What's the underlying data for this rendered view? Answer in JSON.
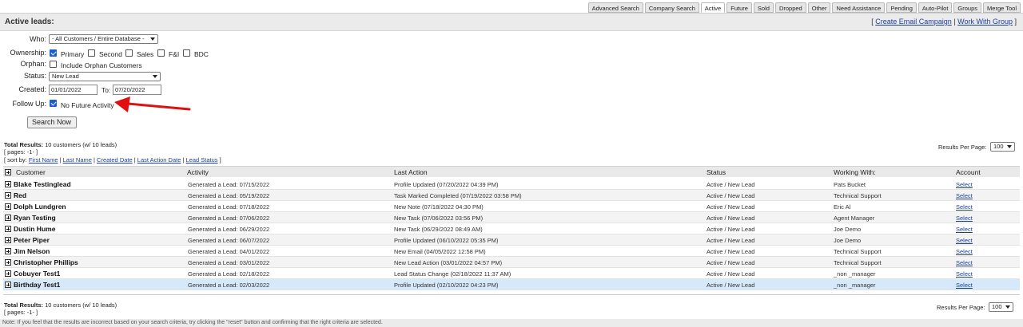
{
  "tabs": [
    {
      "label": "Advanced Search",
      "active": false
    },
    {
      "label": "Company Search",
      "active": false
    },
    {
      "label": "Active",
      "active": true
    },
    {
      "label": "Future",
      "active": false
    },
    {
      "label": "Sold",
      "active": false
    },
    {
      "label": "Dropped",
      "active": false
    },
    {
      "label": "Other",
      "active": false
    },
    {
      "label": "Need Assistance",
      "active": false
    },
    {
      "label": "Pending",
      "active": false
    },
    {
      "label": "Auto-Pilot",
      "active": false
    },
    {
      "label": "Groups",
      "active": false
    },
    {
      "label": "Merge Tool",
      "active": false
    }
  ],
  "header": {
    "title": "Active leads:",
    "link_open": "[ ",
    "create_email_campaign": "Create Email Campaign",
    "link_sep": " | ",
    "work_with_group": "Work With Group",
    "link_close": " ]"
  },
  "filters": {
    "who_label": "Who:",
    "who_value": "- All Customers / Entire Database -",
    "ownership_label": "Ownership:",
    "primary": "Primary",
    "second": "Second",
    "sales": "Sales",
    "fi": "F&I",
    "bdc": "BDC",
    "orphan_label": "Orphan:",
    "include_orphan": "Include Orphan Customers",
    "status_label": "Status:",
    "status_value": "New Lead",
    "created_label": "Created:",
    "created_from": "01/01/2022",
    "to_label": "To:",
    "created_to": "07/20/2022",
    "followup_label": "Follow Up:",
    "no_future_activity": "No Future Activity",
    "search_button": "Search Now"
  },
  "results": {
    "total_label": "Total Results:",
    "total_text": " 10 customers (w/ 10 leads)",
    "pages_text": "[ pages: -1- ]",
    "sort_prefix": "[ sort by: ",
    "sort_first_name": "First Name",
    "sort_last_name": "Last Name",
    "sort_created_date": "Created Date",
    "sort_last_action_date": "Last Action Date",
    "sort_lead_status": "Lead Status",
    "sort_suffix": " ]",
    "sep": " | ",
    "per_page_label": "Results Per Page:",
    "per_page_value": "100"
  },
  "table": {
    "columns": {
      "customer": "Customer",
      "activity": "Activity",
      "last_action": "Last Action",
      "status": "Status",
      "working_with": "Working With:",
      "account": "Account"
    },
    "rows": [
      {
        "name": "Blake Testinglead",
        "activity": "Generated a Lead: 07/15/2022",
        "last_action": "Profile Updated  (07/20/2022 04:39 PM)",
        "status": "Active / New Lead",
        "working_with": "Pats Bucket",
        "account": "Select"
      },
      {
        "name": "Red",
        "activity": "Generated a Lead: 05/19/2022",
        "last_action": "Task Marked Completed (07/19/2022 03:58 PM)",
        "status": "Active / New Lead",
        "working_with": "Technical Support",
        "account": "Select"
      },
      {
        "name": "Dolph Lundgren",
        "activity": "Generated a Lead: 07/18/2022",
        "last_action": "New Note (07/18/2022 04:30 PM)",
        "status": "Active / New Lead",
        "working_with": "Eric Al",
        "account": "Select"
      },
      {
        "name": "Ryan Testing",
        "activity": "Generated a Lead: 07/06/2022",
        "last_action": "New Task (07/06/2022 03:56 PM)",
        "status": "Active / New Lead",
        "working_with": "Agent Manager",
        "account": "Select"
      },
      {
        "name": "Dustin Hume",
        "activity": "Generated a Lead: 06/29/2022",
        "last_action": "New Task (06/29/2022 08:49 AM)",
        "status": "Active / New Lead",
        "working_with": "Joe Demo",
        "account": "Select"
      },
      {
        "name": "Peter Piper",
        "activity": "Generated a Lead: 06/07/2022",
        "last_action": "Profile Updated  (06/10/2022 05:35 PM)",
        "status": "Active / New Lead",
        "working_with": "Joe Demo",
        "account": "Select"
      },
      {
        "name": "Jim Nelson",
        "activity": "Generated a Lead: 04/01/2022",
        "last_action": "New Email (04/05/2022 12:58 PM)",
        "status": "Active / New Lead",
        "working_with": "Technical Support",
        "account": "Select"
      },
      {
        "name": "Christopher Phillips",
        "activity": "Generated a Lead: 03/01/2022",
        "last_action": "New Lead Action (03/01/2022 04:57 PM)",
        "status": "Active / New Lead",
        "working_with": "Technical Support",
        "account": "Select"
      },
      {
        "name": "Cobuyer Test1",
        "activity": "Generated a Lead: 02/18/2022",
        "last_action": "Lead Status Change (02/18/2022 11:37 AM)",
        "status": "Active / New Lead",
        "working_with": "_non _manager",
        "account": "Select"
      },
      {
        "name": "Birthday Test1",
        "activity": "Generated a Lead: 02/03/2022",
        "last_action": "Profile Updated  (02/10/2022 04:23 PM)",
        "status": "Active / New Lead",
        "working_with": "_non _manager",
        "account": "Select"
      }
    ]
  },
  "footer": {
    "note": "Note: If you feel that the results are incorrect based on your search criteria, try clicking the \"reset\" button and confirming that the right criteria are selected."
  },
  "colors": {
    "annotation_arrow": "#e01010",
    "link": "#1a3ea8",
    "highlight_row": "#d6e9fb"
  }
}
